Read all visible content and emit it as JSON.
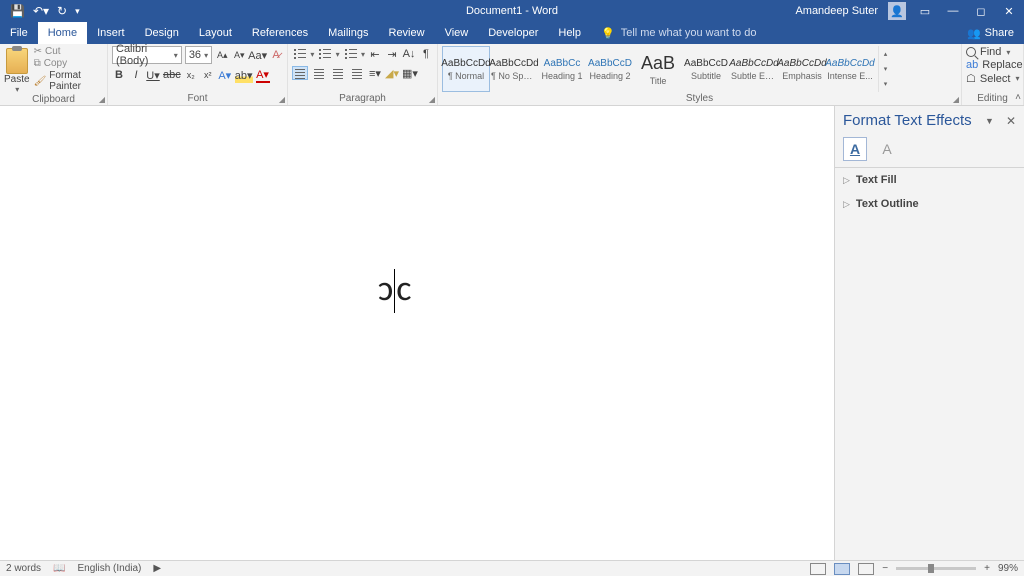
{
  "titlebar": {
    "doc_title": "Document1 - Word",
    "user_name": "Amandeep Suter"
  },
  "menu": {
    "file": "File",
    "home": "Home",
    "insert": "Insert",
    "design": "Design",
    "layout": "Layout",
    "references": "References",
    "mailings": "Mailings",
    "review": "Review",
    "view": "View",
    "developer": "Developer",
    "help": "Help",
    "tellme": "Tell me what you want to do",
    "share": "Share"
  },
  "ribbon": {
    "clipboard": {
      "label": "Clipboard",
      "paste": "Paste",
      "cut": "Cut",
      "copy": "Copy",
      "format_painter": "Format Painter"
    },
    "font": {
      "label": "Font",
      "font_name": "Calibri (Body)",
      "font_size": "36"
    },
    "paragraph": {
      "label": "Paragraph"
    },
    "styles": {
      "label": "Styles",
      "items": [
        {
          "preview": "AaBbCcDd",
          "name": "¶ Normal",
          "cls": ""
        },
        {
          "preview": "AaBbCcDd",
          "name": "¶ No Spac...",
          "cls": ""
        },
        {
          "preview": "AaBbCc",
          "name": "Heading 1",
          "cls": "blue"
        },
        {
          "preview": "AaBbCcD",
          "name": "Heading 2",
          "cls": "blue"
        },
        {
          "preview": "AaB",
          "name": "Title",
          "cls": "title"
        },
        {
          "preview": "AaBbCcD",
          "name": "Subtitle",
          "cls": ""
        },
        {
          "preview": "AaBbCcDd",
          "name": "Subtle Em...",
          "cls": "italic"
        },
        {
          "preview": "AaBbCcDd",
          "name": "Emphasis",
          "cls": "italic"
        },
        {
          "preview": "AaBbCcDd",
          "name": "Intense E...",
          "cls": "blue italic"
        }
      ]
    },
    "editing": {
      "label": "Editing",
      "find": "Find",
      "replace": "Replace",
      "select": "Select"
    }
  },
  "sidepane": {
    "title": "Format Text Effects",
    "text_fill": "Text Fill",
    "text_outline": "Text Outline"
  },
  "document": {
    "content": "ↄc"
  },
  "statusbar": {
    "words": "2 words",
    "language": "English (India)",
    "zoom": "99%"
  }
}
